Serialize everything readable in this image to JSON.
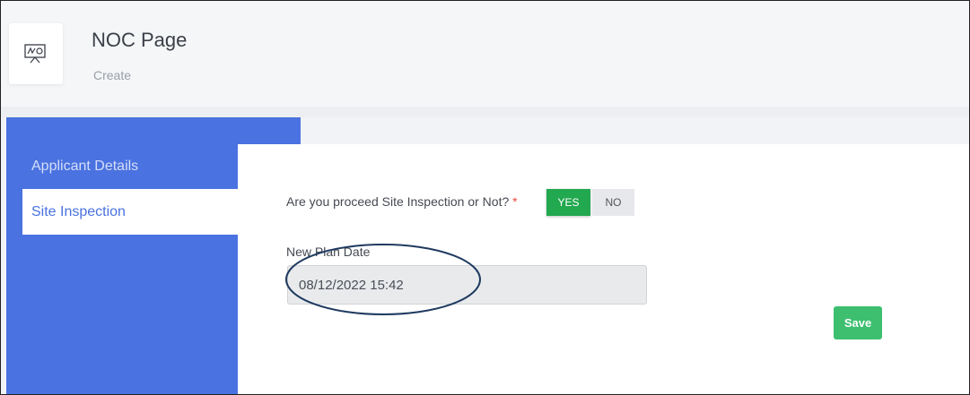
{
  "header": {
    "icon": "presentation-board-icon",
    "title": "NOC Page",
    "subtitle": "Create"
  },
  "sidebar": {
    "items": [
      {
        "label": "Applicant Details",
        "active": false
      },
      {
        "label": "Site Inspection",
        "active": true
      }
    ],
    "color": "#4a72e0"
  },
  "form": {
    "question_label": "Are you proceed Site Inspection or Not?",
    "required_marker": "*",
    "yes_label": "YES",
    "no_label": "NO",
    "selected": "YES",
    "date_label": "New Plan Date",
    "date_value": "08/12/2022 15:42",
    "save_label": "Save"
  },
  "colors": {
    "accent": "#4a72e0",
    "yes_active": "#22a84f",
    "save": "#3dbf6f",
    "required": "#e74c3c"
  }
}
